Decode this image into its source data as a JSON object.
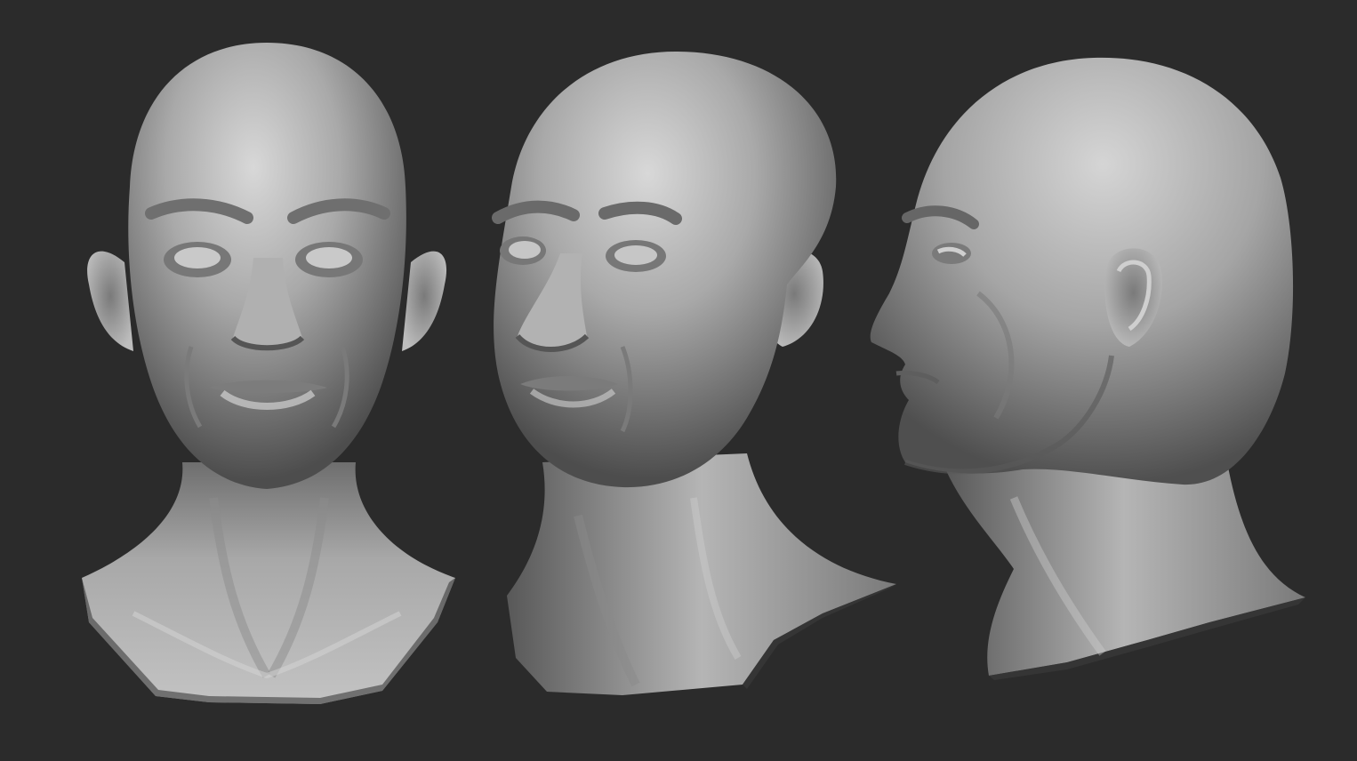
{
  "scene": {
    "background_color": "#2b2b2b",
    "views": [
      {
        "view": "front",
        "icon": "sculpt-head-front-view"
      },
      {
        "view": "three-quarter",
        "icon": "sculpt-head-three-quarter-view"
      },
      {
        "view": "profile",
        "icon": "sculpt-head-profile-view"
      }
    ]
  },
  "colors": {
    "clay_light": "#dcdcdc",
    "clay_mid": "#a7a7a7",
    "clay_dark": "#5b5b5b",
    "clay_shadow": "#3a3a3a"
  }
}
